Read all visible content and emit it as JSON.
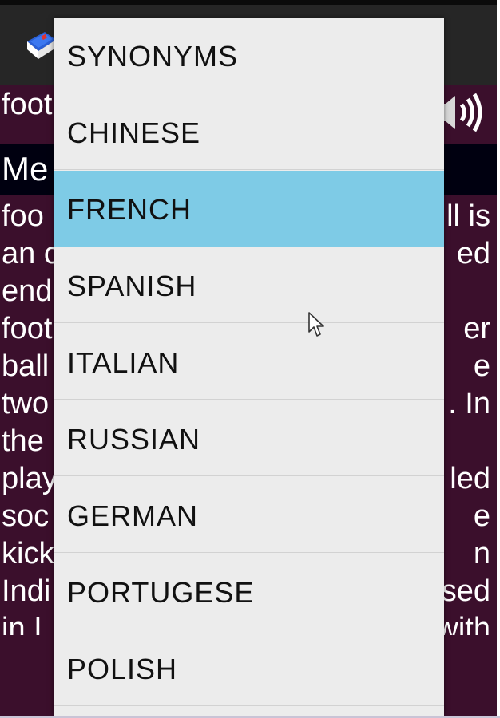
{
  "word_field": {
    "text": "foot"
  },
  "meaning_header": {
    "title": "Me"
  },
  "definition_lines": [
    {
      "left": " foo",
      "right": "ll is"
    },
    {
      "left": "an c",
      "right": "ed"
    },
    {
      "left": "end",
      "right": ""
    },
    {
      "left": "foot",
      "right": "er"
    },
    {
      "left": "ball",
      "right": "e"
    },
    {
      "left": "two",
      "right": ". In"
    },
    {
      "left": "the",
      "right": ""
    },
    {
      "left": "play",
      "right": "led"
    },
    {
      "left": "soc",
      "right": "e"
    },
    {
      "left": "kick",
      "right": "n"
    },
    {
      "left": "Indi",
      "right": "sed"
    },
    {
      "left": "in I",
      "right": "with"
    }
  ],
  "dropdown": {
    "selected": "FRENCH",
    "items": [
      {
        "label": "SYNONYMS"
      },
      {
        "label": "CHINESE"
      },
      {
        "label": "FRENCH"
      },
      {
        "label": "SPANISH"
      },
      {
        "label": "ITALIAN"
      },
      {
        "label": "RUSSIAN"
      },
      {
        "label": "GERMAN"
      },
      {
        "label": "PORTUGESE"
      },
      {
        "label": "POLISH"
      }
    ]
  },
  "colors": {
    "background": "#3b0f2c",
    "action_bar": "#262626",
    "meaning_bar": "#000010",
    "dropdown_bg": "#ececec",
    "selected_item": "#7ecbe6"
  },
  "icons": {
    "app": "book-icon",
    "speaker": "speaker-icon",
    "pointer": "mouse-pointer-icon"
  }
}
